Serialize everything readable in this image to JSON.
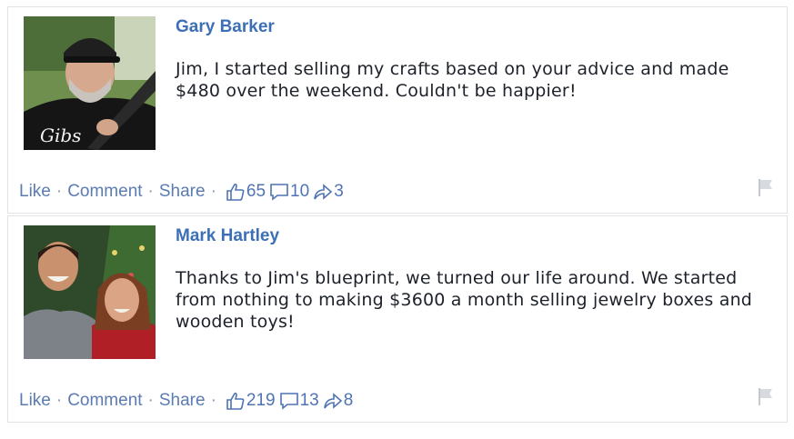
{
  "actions": {
    "like": "Like",
    "comment": "Comment",
    "share": "Share",
    "sep": "·"
  },
  "posts": [
    {
      "author": "Gary Barker",
      "message": "Jim, I started selling my crafts based on your advice and made $480 over the weekend. Couldn't be happier!",
      "likes": "65",
      "comments": "10",
      "shares": "3",
      "avatar_shirt_text": "Gibs"
    },
    {
      "author": "Mark Hartley",
      "message": "Thanks to Jim's blueprint, we turned our life around. We started from nothing to making $3600 a month selling jewelry boxes and wooden toys!",
      "likes": "219",
      "comments": "13",
      "shares": "8"
    }
  ],
  "colors": {
    "name": "#3b6fb6",
    "link": "#5b7bb3",
    "text": "#1d2129",
    "border": "#e1e2e5"
  },
  "icons": [
    "thumbs-up-icon",
    "comment-bubble-icon",
    "share-arrow-icon",
    "flag-icon"
  ]
}
